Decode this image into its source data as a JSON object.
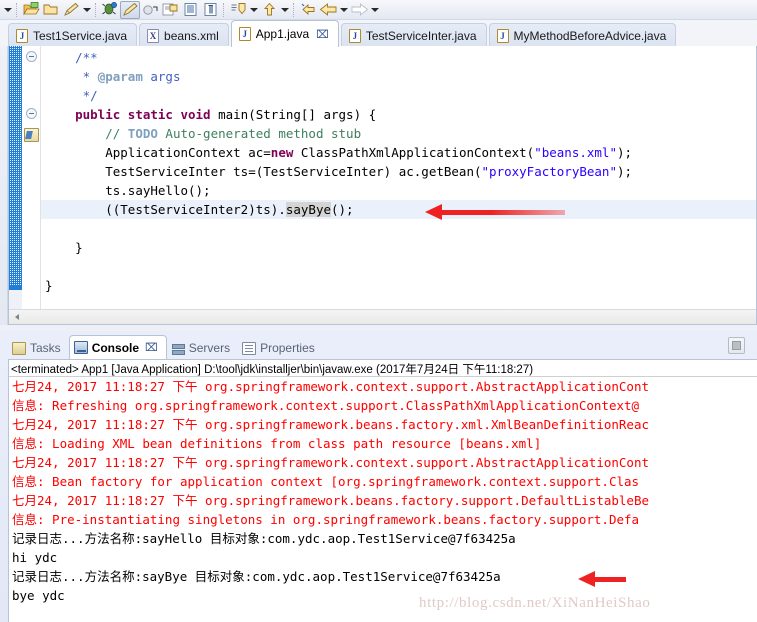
{
  "toolbar": {
    "buttons": [
      {
        "name": "dropdown-arrow-left",
        "type": "arrow"
      },
      {
        "name": "open-folder-icon",
        "type": "icon",
        "glyph": "folder-open"
      },
      {
        "name": "folder-icon",
        "type": "icon",
        "glyph": "folder"
      },
      {
        "name": "pencil-icon",
        "type": "icon",
        "glyph": "pencil"
      },
      {
        "name": "pencil-dropdown-arrow",
        "type": "arrow"
      },
      {
        "name": "debug-icon",
        "type": "icon",
        "glyph": "bug"
      },
      {
        "name": "run-icon",
        "type": "icon",
        "glyph": "run-pencil",
        "pressed": true
      },
      {
        "name": "run-external-icon",
        "type": "icon",
        "glyph": "run-ext"
      },
      {
        "name": "new-java-class-icon",
        "type": "icon",
        "glyph": "class"
      },
      {
        "name": "outline-icon",
        "type": "icon",
        "glyph": "list"
      },
      {
        "name": "paragraph-icon",
        "type": "icon",
        "glyph": "pilcrow"
      },
      {
        "name": "search-next-icon",
        "type": "icon",
        "glyph": "search-down"
      },
      {
        "name": "search-dropdown-arrow",
        "type": "arrow"
      },
      {
        "name": "up-arrow-icon",
        "type": "icon",
        "glyph": "up"
      },
      {
        "name": "up-dropdown-arrow",
        "type": "arrow"
      },
      {
        "name": "back-icon",
        "type": "icon",
        "glyph": "back-small"
      },
      {
        "name": "back-large-icon",
        "type": "icon",
        "glyph": "back"
      },
      {
        "name": "back-dropdown-arrow",
        "type": "arrow"
      },
      {
        "name": "forward-icon",
        "type": "icon",
        "glyph": "forward"
      },
      {
        "name": "forward-dropdown-arrow",
        "type": "arrow"
      }
    ]
  },
  "editor_tabs": [
    {
      "label": "Test1Service.java",
      "icon": "J",
      "kind": "java",
      "active": false,
      "closable": false
    },
    {
      "label": "beans.xml",
      "icon": "X",
      "kind": "xml",
      "active": false,
      "closable": false
    },
    {
      "label": "App1.java",
      "icon": "J",
      "kind": "java",
      "active": true,
      "closable": true,
      "close_glyph": "⌧"
    },
    {
      "label": "TestServiceInter.java",
      "icon": "J",
      "kind": "java",
      "active": false,
      "closable": false
    },
    {
      "label": "MyMethodBeforeAdvice.java",
      "icon": "J",
      "kind": "java",
      "active": false,
      "closable": false
    }
  ],
  "code": {
    "lines": [
      {
        "id": "l1",
        "indent": 4,
        "segments": [
          {
            "t": "/**",
            "c": "jdoc"
          }
        ]
      },
      {
        "id": "l2",
        "indent": 4,
        "segments": [
          {
            "t": " * ",
            "c": "jdoc"
          },
          {
            "t": "@param",
            "c": "jdoc-tag"
          },
          {
            "t": " args",
            "c": "jdoc"
          }
        ]
      },
      {
        "id": "l3",
        "indent": 4,
        "segments": [
          {
            "t": " */",
            "c": "jdoc"
          }
        ]
      },
      {
        "id": "l4",
        "indent": 4,
        "segments": [
          {
            "t": "public static void ",
            "c": "kw"
          },
          {
            "t": "main(String[] args) {",
            "c": ""
          }
        ]
      },
      {
        "id": "l5",
        "indent": 8,
        "segments": [
          {
            "t": "// ",
            "c": "cmt"
          },
          {
            "t": "TODO",
            "c": "todo"
          },
          {
            "t": " Auto-generated method stub",
            "c": "cmt"
          }
        ]
      },
      {
        "id": "l6",
        "indent": 8,
        "segments": [
          {
            "t": "ApplicationContext ac=",
            "c": ""
          },
          {
            "t": "new",
            "c": "kw"
          },
          {
            "t": " ClassPathXmlApplicationContext(",
            "c": ""
          },
          {
            "t": "\"beans.xml\"",
            "c": "str"
          },
          {
            "t": ");",
            "c": ""
          }
        ]
      },
      {
        "id": "l7",
        "indent": 8,
        "segments": [
          {
            "t": "TestServiceInter ts=(TestServiceInter) ac.getBean(",
            "c": ""
          },
          {
            "t": "\"proxyFactoryBean\"",
            "c": "str"
          },
          {
            "t": ");",
            "c": ""
          }
        ]
      },
      {
        "id": "l8",
        "indent": 8,
        "segments": [
          {
            "t": "ts.sayHello();",
            "c": ""
          }
        ]
      },
      {
        "id": "l9",
        "indent": 8,
        "highlight": true,
        "segments": [
          {
            "t": "((TestServiceInter2)ts).",
            "c": ""
          },
          {
            "t": "sayBye",
            "c": "sel"
          },
          {
            "t": "();",
            "c": ""
          }
        ]
      },
      {
        "id": "l10",
        "indent": 0,
        "segments": [
          {
            "t": "",
            "c": ""
          }
        ]
      },
      {
        "id": "l11",
        "indent": 4,
        "segments": [
          {
            "t": "}",
            "c": ""
          }
        ]
      },
      {
        "id": "l12",
        "indent": 0,
        "segments": [
          {
            "t": "",
            "c": ""
          }
        ]
      },
      {
        "id": "l13",
        "indent": 0,
        "segments": [
          {
            "t": "}",
            "c": ""
          }
        ]
      }
    ]
  },
  "view_tabs": [
    {
      "label": "Tasks",
      "icon": "tasks",
      "active": false,
      "closable": false
    },
    {
      "label": "Console",
      "icon": "console",
      "active": true,
      "closable": true,
      "close_glyph": "⌧"
    },
    {
      "label": "Servers",
      "icon": "servers",
      "active": false,
      "closable": false
    },
    {
      "label": "Properties",
      "icon": "props",
      "active": false,
      "closable": false
    }
  ],
  "console": {
    "header": "<terminated> App1 [Java Application] D:\\tool\\jdk\\installjer\\bin\\javaw.exe (2017年7月24日 下午11:18:27)",
    "lines": [
      {
        "text": "七月24, 2017 11:18:27 下午 org.springframework.context.support.AbstractApplicationCont",
        "stream": "err"
      },
      {
        "text": "信息: Refreshing org.springframework.context.support.ClassPathXmlApplicationContext@",
        "stream": "err"
      },
      {
        "text": "七月24, 2017 11:18:27 下午 org.springframework.beans.factory.xml.XmlBeanDefinitionReac",
        "stream": "err"
      },
      {
        "text": "信息: Loading XML bean definitions from class path resource [beans.xml]",
        "stream": "err"
      },
      {
        "text": "七月24, 2017 11:18:27 下午 org.springframework.context.support.AbstractApplicationCont",
        "stream": "err"
      },
      {
        "text": "信息: Bean factory for application context [org.springframework.context.support.Clas",
        "stream": "err"
      },
      {
        "text": "七月24, 2017 11:18:27 下午 org.springframework.beans.factory.support.DefaultListableBe",
        "stream": "err"
      },
      {
        "text": "信息: Pre-instantiating singletons in org.springframework.beans.factory.support.Defa",
        "stream": "err"
      },
      {
        "text": "记录日志...方法名称:sayHello 目标对象:com.ydc.aop.Test1Service@7f63425a",
        "stream": "out"
      },
      {
        "text": "hi ydc",
        "stream": "out"
      },
      {
        "text": "记录日志...方法名称:sayBye 目标对象:com.ydc.aop.Test1Service@7f63425a",
        "stream": "out"
      },
      {
        "text": "bye ydc",
        "stream": "out"
      }
    ],
    "stop_button_label": "stop-icon"
  },
  "annotations": {
    "arrow_editor": {
      "name": "red-arrow-code",
      "color": "#ee2222"
    },
    "arrow_console": {
      "name": "red-arrow-console",
      "color": "#ee2222"
    }
  },
  "watermark": {
    "text": "http://blog.csdn.net/XiNanHeiShao"
  },
  "colors": {
    "keyword": "#7f0055",
    "string": "#2a00ff",
    "comment": "#3f7f5f",
    "javadoc": "#3f5fbf",
    "console_error": "#ff0000",
    "console_out": "#000000",
    "accent": "#ee2222"
  }
}
